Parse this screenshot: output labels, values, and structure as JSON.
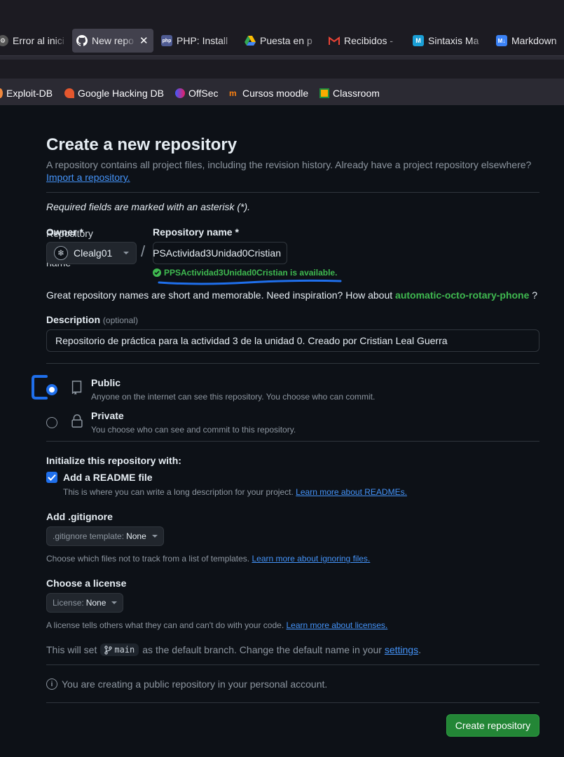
{
  "browser": {
    "tabs": [
      {
        "label": "Error al inici",
        "icon": "error-icon",
        "active": false
      },
      {
        "label": "New repo",
        "icon": "github-icon",
        "active": true
      },
      {
        "label": "PHP: Install",
        "icon": "php-icon",
        "active": false
      },
      {
        "label": "Puesta en p",
        "icon": "google-drive-icon",
        "active": false
      },
      {
        "label": "Recibidos -",
        "icon": "gmail-icon",
        "active": false
      },
      {
        "label": "Sintaxis Ma",
        "icon": "sintaxis-icon",
        "active": false
      },
      {
        "label": "Markdown",
        "icon": "markdown-icon",
        "active": false
      }
    ],
    "bookmarks": [
      {
        "label": "Exploit-DB",
        "icon": "exploit-db-icon"
      },
      {
        "label": "Google Hacking DB",
        "icon": "ghdb-icon"
      },
      {
        "label": "OffSec",
        "icon": "offsec-icon"
      },
      {
        "label": "Cursos moodle",
        "icon": "moodle-icon"
      },
      {
        "label": "Classroom",
        "icon": "classroom-icon"
      }
    ]
  },
  "form": {
    "title": "Create a new repository",
    "subtitle": "A repository contains all project files, including the revision history. Already have a project repository elsewhere?",
    "import_link": "Import a repository.",
    "required_note": "Required fields are marked with an asterisk (*).",
    "owner_label": "Owner *",
    "owner_hidden_label": "Repository owner and name",
    "owner_value": "Clealg01",
    "separator": "/",
    "repo_label": "Repository name *",
    "repo_value": "PPSActividad3Unidad0Cristian",
    "availability": "PPSActividad3Unidad0Cristian is available.",
    "great_text": "Great repository names are short and memorable. Need inspiration? How about",
    "suggestion": "automatic-octo-rotary-phone",
    "great_suffix": "?",
    "description_label": "Description",
    "description_optional": "(optional)",
    "description_value": "Repositorio de práctica para la actividad 3 de la unidad 0. Creado por Cristian Leal Guerra",
    "visibility": [
      {
        "title": "Public",
        "desc": "Anyone on the internet can see this repository. You choose who can commit.",
        "selected": true
      },
      {
        "title": "Private",
        "desc": "You choose who can see and commit to this repository.",
        "selected": false
      }
    ],
    "init_title": "Initialize this repository with:",
    "readme_title": "Add a README file",
    "readme_desc": "This is where you can write a long description for your project.",
    "readme_link": "Learn more about READMEs.",
    "readme_checked": true,
    "gitignore_title": "Add .gitignore",
    "gitignore_prefix": ".gitignore template:",
    "gitignore_value": "None",
    "gitignore_help": "Choose which files not to track from a list of templates.",
    "gitignore_link": "Learn more about ignoring files.",
    "license_title": "Choose a license",
    "license_prefix": "License:",
    "license_value": "None",
    "license_help": "A license tells others what they can and can't do with your code.",
    "license_link": "Learn more about licenses.",
    "branch_prefix": "This will set",
    "branch_name": "main",
    "branch_middle": "as the default branch. Change the default name in your",
    "branch_link": "settings",
    "branch_suffix": ".",
    "info_text": "You are creating a public repository in your personal account.",
    "create_button": "Create repository"
  },
  "colors": {
    "page_bg": "#0d1117",
    "accent_blue": "#1f6feb",
    "success_green": "#3fb950",
    "button_green": "#238636",
    "annotation_blue": "#1f6feb"
  }
}
